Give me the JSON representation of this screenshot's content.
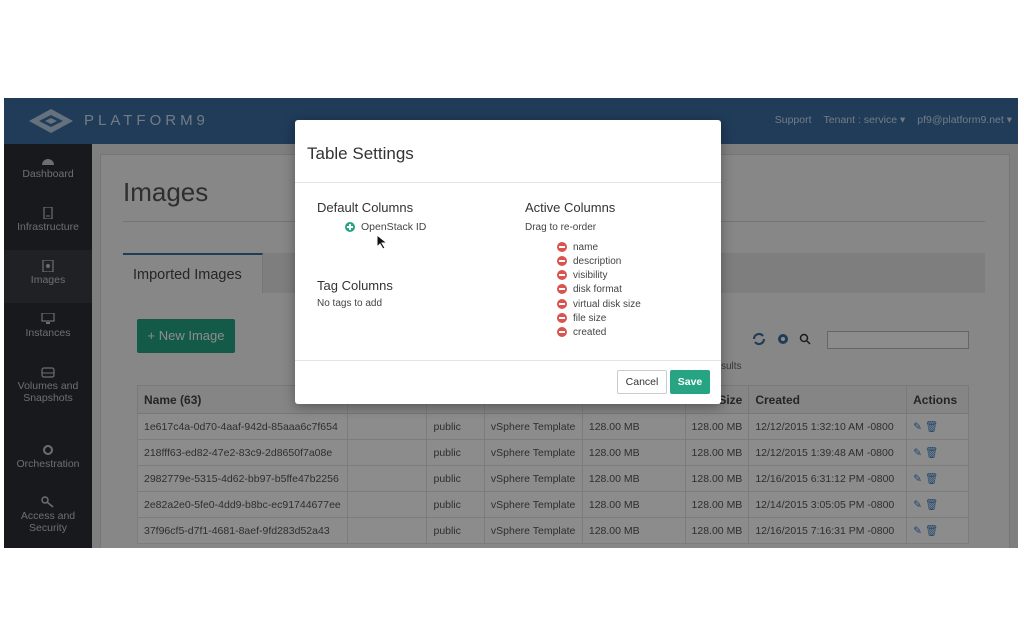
{
  "brand": {
    "name": "PLATFORM9"
  },
  "topnav": {
    "support": "Support",
    "tenant": "Tenant : service ▾",
    "user": "pf9@platform9.net ▾"
  },
  "sidebar": {
    "items": [
      {
        "label": "Dashboard",
        "icon": "dashboard-icon"
      },
      {
        "label": "Infrastructure",
        "icon": "server-icon"
      },
      {
        "label": "Images",
        "icon": "image-icon"
      },
      {
        "label": "Instances",
        "icon": "monitor-icon"
      },
      {
        "label": "Volumes and Snapshots",
        "icon": "disk-icon"
      },
      {
        "label": "Orchestration",
        "icon": "gears-icon"
      },
      {
        "label": "Access and Security",
        "icon": "key-icon"
      }
    ]
  },
  "main": {
    "title": "Images",
    "tab": "Imported Images",
    "new_button": "+ New Image",
    "results": "sults",
    "table": {
      "headers": [
        "Name (63)",
        "",
        "",
        "",
        "",
        "Size",
        "Created",
        "Actions"
      ],
      "rows": [
        [
          "1e617c4a-0d70-4aaf-942d-85aaa6c7f654",
          "",
          "public",
          "vSphere Template",
          "128.00 MB",
          "128.00 MB",
          "12/12/2015 1:32:10 AM -0800"
        ],
        [
          "218fff63-ed82-47e2-83c9-2d8650f7a08e",
          "",
          "public",
          "vSphere Template",
          "128.00 MB",
          "128.00 MB",
          "12/12/2015 1:39:48 AM -0800"
        ],
        [
          "2982779e-5315-4d62-bb97-b5ffe47b2256",
          "",
          "public",
          "vSphere Template",
          "128.00 MB",
          "128.00 MB",
          "12/16/2015 6:31:12 PM -0800"
        ],
        [
          "2e82a2e0-5fe0-4dd9-b8bc-ec91744677ee",
          "",
          "public",
          "vSphere Template",
          "128.00 MB",
          "128.00 MB",
          "12/14/2015 3:05:05 PM -0800"
        ],
        [
          "37f96cf5-d7f1-4681-8aef-9fd283d52a43",
          "",
          "public",
          "vSphere Template",
          "128.00 MB",
          "128.00 MB",
          "12/16/2015 7:16:31 PM -0800"
        ]
      ]
    }
  },
  "modal": {
    "title": "Table Settings",
    "default_columns": {
      "heading": "Default Columns",
      "items": [
        "OpenStack ID"
      ]
    },
    "tag_columns": {
      "heading": "Tag Columns",
      "empty": "No tags to add"
    },
    "active_columns": {
      "heading": "Active Columns",
      "hint": "Drag to re-order",
      "items": [
        "name",
        "description",
        "visibility",
        "disk format",
        "virtual disk size",
        "file size",
        "created"
      ]
    },
    "cancel": "Cancel",
    "save": "Save"
  },
  "colors": {
    "topbar": "#3b6ea2",
    "sidebar": "#2c2f33",
    "accent_green": "#26a483",
    "remove_red": "#d9534f"
  }
}
